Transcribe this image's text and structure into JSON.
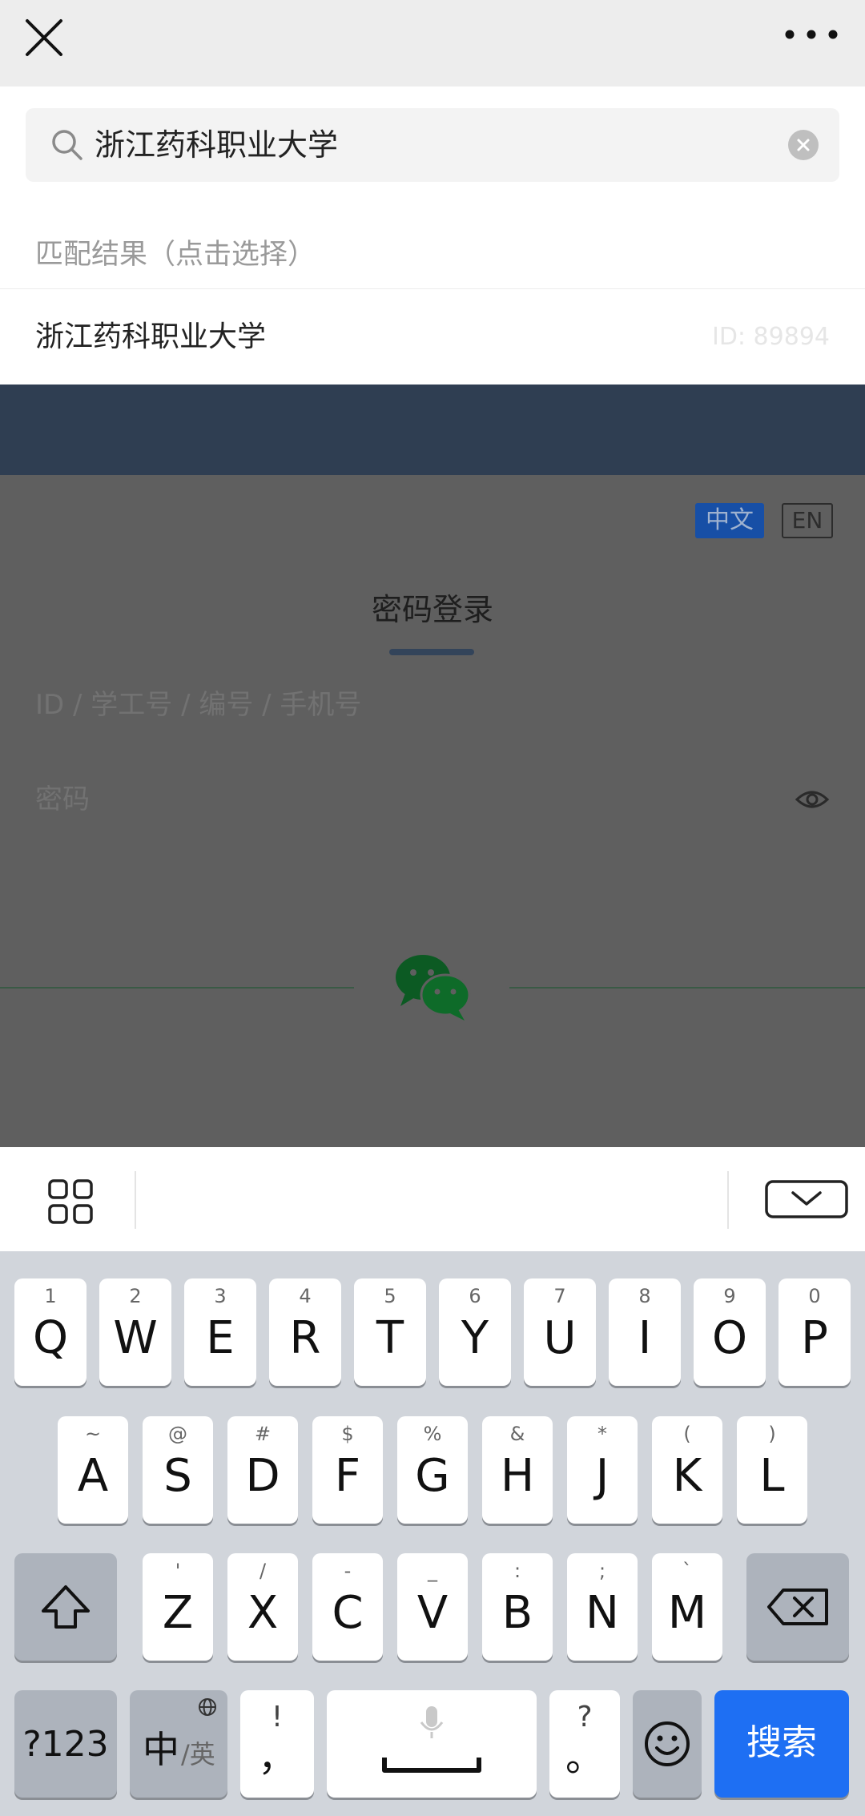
{
  "topbar": {
    "close_icon": "close-icon",
    "more_icon": "more-horizontal-icon"
  },
  "search": {
    "query": "浙江药科职业大学",
    "search_icon": "search-icon",
    "clear_icon": "clear-icon"
  },
  "results": {
    "label": "匹配结果（点击选择）",
    "items": [
      {
        "name": "浙江药科职业大学",
        "id": "ID: 89894"
      }
    ]
  },
  "background_page": {
    "lang_zh": "中文",
    "lang_en": "EN",
    "login_title": "密码登录",
    "id_placeholder": "ID / 学工号 / 编号 / 手机号",
    "password_placeholder": "密码",
    "eye_icon": "eye-icon",
    "wechat_icon": "wechat-icon"
  },
  "keyboard_toolbar": {
    "grid_icon": "grid-icon",
    "hide_keyboard_icon": "hide-keyboard-icon"
  },
  "keyboard": {
    "row1": [
      {
        "hint": "1",
        "key": "Q"
      },
      {
        "hint": "2",
        "key": "W"
      },
      {
        "hint": "3",
        "key": "E"
      },
      {
        "hint": "4",
        "key": "R"
      },
      {
        "hint": "5",
        "key": "T"
      },
      {
        "hint": "6",
        "key": "Y"
      },
      {
        "hint": "7",
        "key": "U"
      },
      {
        "hint": "8",
        "key": "I"
      },
      {
        "hint": "9",
        "key": "O"
      },
      {
        "hint": "0",
        "key": "P"
      }
    ],
    "row2": [
      {
        "hint": "~",
        "key": "A"
      },
      {
        "hint": "@",
        "key": "S"
      },
      {
        "hint": "#",
        "key": "D"
      },
      {
        "hint": "$",
        "key": "F"
      },
      {
        "hint": "%",
        "key": "G"
      },
      {
        "hint": "&",
        "key": "H"
      },
      {
        "hint": "*",
        "key": "J"
      },
      {
        "hint": "(",
        "key": "K"
      },
      {
        "hint": ")",
        "key": "L"
      }
    ],
    "row3": [
      {
        "hint": "'",
        "key": "Z"
      },
      {
        "hint": "/",
        "key": "X"
      },
      {
        "hint": "-",
        "key": "C"
      },
      {
        "hint": "_",
        "key": "V"
      },
      {
        "hint": ":",
        "key": "B"
      },
      {
        "hint": ";",
        "key": "N"
      },
      {
        "hint": "`",
        "key": "M"
      }
    ],
    "shift_icon": "shift-icon",
    "backspace_icon": "backspace-icon",
    "numbers_label": "?123",
    "lang_main": "中",
    "lang_sub": "/英",
    "globe_icon": "globe-icon",
    "comma_hint": "!",
    "comma_key": "，",
    "mic_icon": "microphone-icon",
    "space_icon": "space-icon",
    "period_hint": "?",
    "period_key": "。",
    "emoji_icon": "emoji-icon",
    "search_key": "搜索",
    "accent": "#1e6ff3"
  }
}
